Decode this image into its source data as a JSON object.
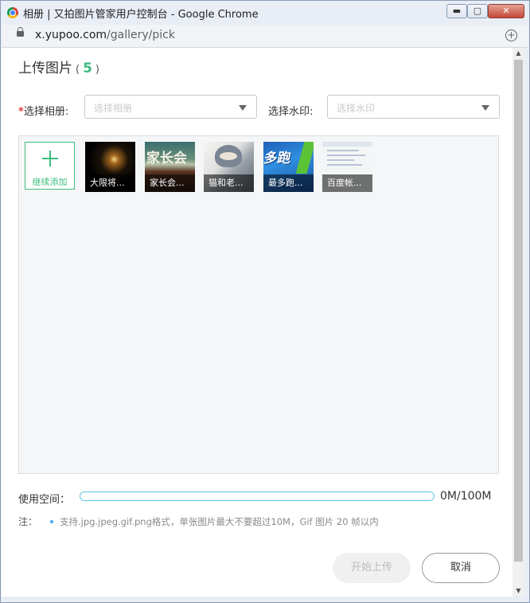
{
  "window": {
    "title": "相册 | 又拍图片管家用户控制台 - Google Chrome",
    "controls": {
      "minimize": "▬",
      "maximize": "▢",
      "close": "✕"
    }
  },
  "address_bar": {
    "host": "x.yupoo.com",
    "path": "/gallery/pick",
    "zoom_icon": "+"
  },
  "dialog": {
    "title": "上传图片",
    "paren_open": "(",
    "paren_close": ")",
    "count": "5",
    "album_required_mark": "*",
    "album_label": "选择相册:",
    "album_placeholder": "选择相册",
    "watermark_label": "选择水印:",
    "watermark_placeholder": "选择水印",
    "add_more_label": "继续添加",
    "thumbnails": [
      {
        "caption": "大限将..."
      },
      {
        "caption": "家长会..."
      },
      {
        "caption": "猫和老..."
      },
      {
        "caption": "最多跑..."
      },
      {
        "caption": "百度帐..."
      }
    ],
    "usage_label": "使用空间：",
    "usage_progress": 0,
    "usage_text": "0M/100M",
    "note_label": "注：",
    "note_text": "支持.jpg.jpeg.gif.png格式，单张图片最大不要超过10M，Gif 图片 20 帧以内",
    "start_button": "开始上传",
    "cancel_button": "取消"
  },
  "thumb_art": {
    "t2_text": "家长会",
    "t4_text": "多跑"
  }
}
